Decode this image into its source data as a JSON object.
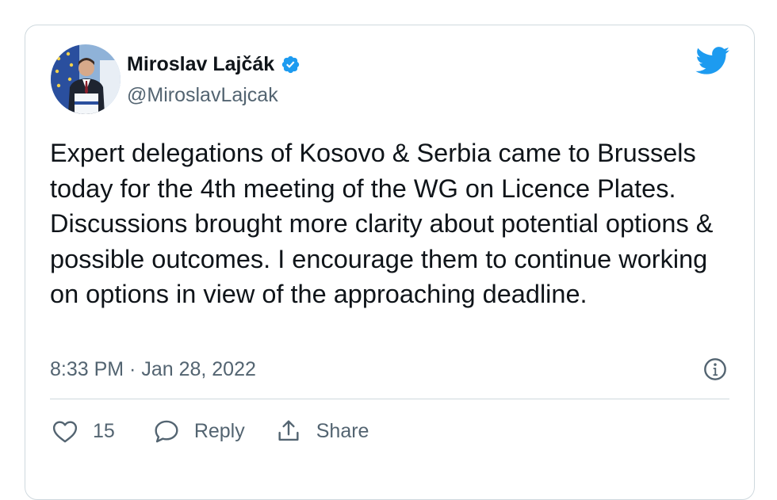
{
  "author": {
    "display_name": "Miroslav Lajčák",
    "handle": "@MiroslavLajcak",
    "verified": true
  },
  "tweet": {
    "text": "Expert delegations of Kosovo & Serbia came to Brussels today for the 4th meeting of the WG on Licence Plates. Discussions brought more clarity about potential options & possible outcomes. I encourage them to continue working on options in view of the approaching deadline.",
    "timestamp": "8:33 PM · Jan 28, 2022"
  },
  "actions": {
    "like_count": "15",
    "reply_label": "Reply",
    "share_label": "Share"
  },
  "icons": {
    "logo": "twitter-bird-icon",
    "verified": "verified-badge-icon",
    "info": "info-icon",
    "like": "heart-icon",
    "reply": "speech-bubble-icon",
    "share": "share-upload-icon"
  },
  "colors": {
    "brand": "#1d9bf0",
    "text": "#0f1419",
    "secondary_text": "#536471",
    "border": "#cfd9de"
  }
}
